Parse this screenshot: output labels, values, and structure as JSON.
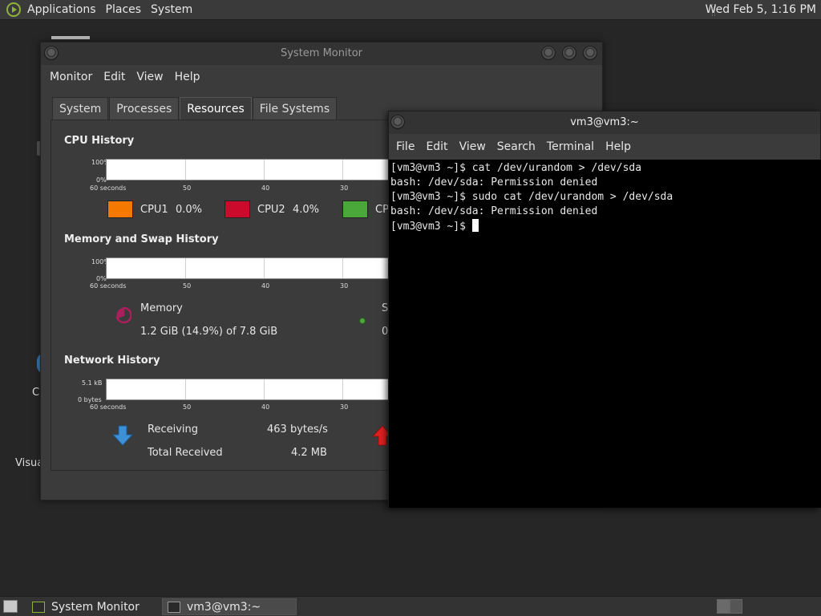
{
  "top_panel": {
    "menus": [
      "Applications",
      "Places",
      "System"
    ],
    "clock": "Wed Feb  5,  1:16 PM"
  },
  "desktop": {
    "fragments": [
      "C",
      "Visua"
    ]
  },
  "sysmon": {
    "title": "System Monitor",
    "menus": [
      "Monitor",
      "Edit",
      "View",
      "Help"
    ],
    "tabs": [
      "System",
      "Processes",
      "Resources",
      "File Systems"
    ],
    "active_tab": "Resources",
    "cpu": {
      "title": "CPU History",
      "y_top": "100%",
      "y_bottom": "0%",
      "x_labels": [
        "60 seconds",
        "50",
        "40",
        "30"
      ],
      "legend": [
        {
          "name": "CPU1",
          "value": "0.0%",
          "color": "#f57900"
        },
        {
          "name": "CPU2",
          "value": "4.0%",
          "color": "#cc0a2c"
        },
        {
          "name": "CP",
          "value": "",
          "color": "#4aa83a"
        }
      ]
    },
    "memory": {
      "title": "Memory and Swap History",
      "y_top": "100%",
      "y_bottom": "0%",
      "x_labels": [
        "60 seconds",
        "50",
        "40",
        "30"
      ],
      "mem_label": "Memory",
      "mem_value": "1.2 GiB (14.9%) of 7.8 GiB",
      "swap_label": "S",
      "swap_value": "0",
      "mem_color": "#ad1f5c",
      "swap_color": "#4aa83a"
    },
    "network": {
      "title": "Network History",
      "y_top": "5.1 kB",
      "y_bottom": "0 bytes",
      "x_labels": [
        "60 seconds",
        "50",
        "40",
        "30"
      ],
      "receiving_label": "Receiving",
      "receiving_value": "463 bytes/s",
      "total_received_label": "Total Received",
      "total_received_value": "4.2 MB"
    }
  },
  "terminal": {
    "title": "vm3@vm3:~",
    "menus": [
      "File",
      "Edit",
      "View",
      "Search",
      "Terminal",
      "Help"
    ],
    "lines": [
      "[vm3@vm3 ~]$ cat /dev/urandom > /dev/sda",
      "bash: /dev/sda: Permission denied",
      "[vm3@vm3 ~]$ sudo cat /dev/urandom > /dev/sda",
      "bash: /dev/sda: Permission denied"
    ],
    "prompt": "[vm3@vm3 ~]$ "
  },
  "bottom_panel": {
    "tasks": [
      "System Monitor",
      "vm3@vm3:~"
    ]
  }
}
